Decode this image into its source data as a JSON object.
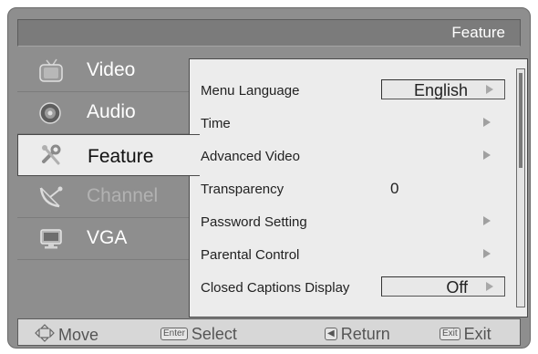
{
  "header": {
    "title": "Feature"
  },
  "sidebar": {
    "items": [
      {
        "label": "Video",
        "icon": "video-icon"
      },
      {
        "label": "Audio",
        "icon": "audio-icon"
      },
      {
        "label": "Feature",
        "icon": "feature-icon",
        "active": true
      },
      {
        "label": "Channel",
        "icon": "channel-icon",
        "dimmed": true
      },
      {
        "label": "VGA",
        "icon": "vga-icon"
      }
    ]
  },
  "menu": {
    "rows": [
      {
        "label": "Menu Language",
        "value": "English",
        "has_arrow": true,
        "value_box": true
      },
      {
        "label": "Time",
        "has_arrow": true
      },
      {
        "label": "Advanced Video",
        "has_arrow": true
      },
      {
        "label": "Transparency",
        "value": "0"
      },
      {
        "label": "Password Setting",
        "has_arrow": true
      },
      {
        "label": "Parental Control",
        "has_arrow": true
      },
      {
        "label": "Closed Captions Display",
        "value": "Off",
        "has_arrow": true,
        "value_box": true
      }
    ],
    "scroll_fraction": 0.4
  },
  "footer": {
    "move_label": "Move",
    "select_key": "Enter",
    "select_label": "Select",
    "return_label": "Return",
    "exit_key": "Exit",
    "exit_label": "Exit"
  },
  "colors": {
    "frame": "#8e8e8e",
    "panel": "#ececec",
    "text_dark": "#222222",
    "text_light": "#ffffff"
  }
}
